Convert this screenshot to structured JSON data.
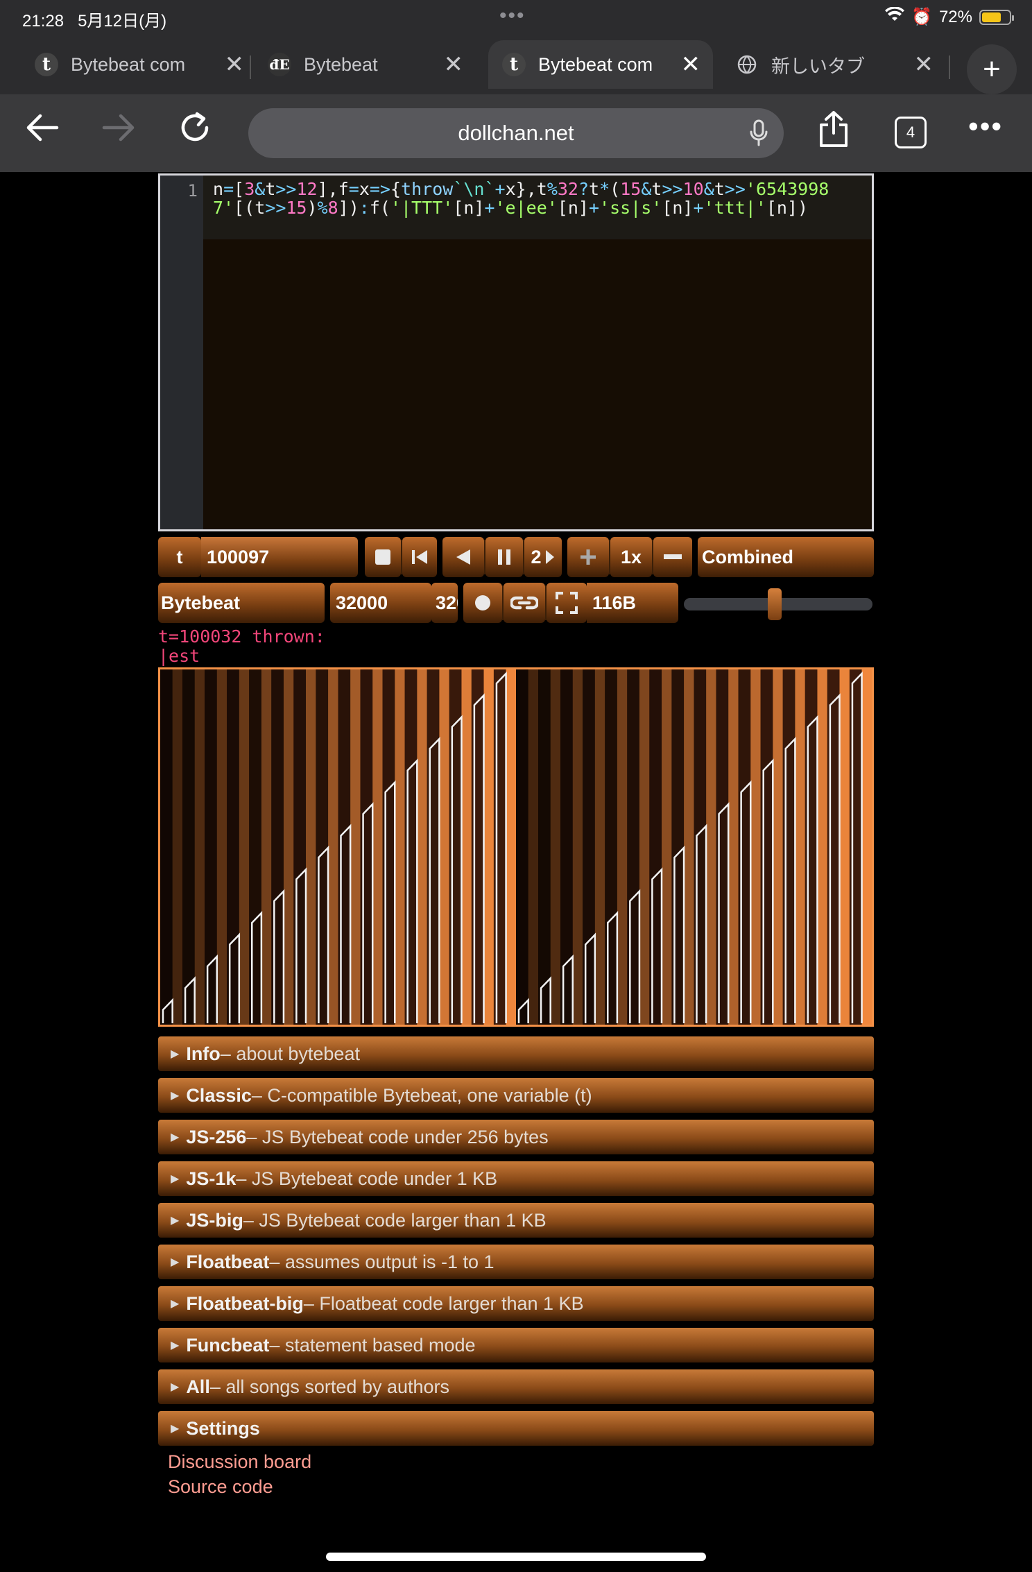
{
  "status_bar": {
    "time": "21:28",
    "date": "5月12日(月)",
    "battery": "72%",
    "battery_level": 0.72
  },
  "tabs": [
    {
      "favicon": "t",
      "title": "Bytebeat com",
      "active": false
    },
    {
      "favicon": "đE",
      "title": "Bytebeat",
      "active": false
    },
    {
      "favicon": "t",
      "title": "Bytebeat com",
      "active": true
    },
    {
      "favicon": "globe-icon",
      "title": "新しいタブ",
      "active": false
    }
  ],
  "toolbar": {
    "url": "dollchan.net",
    "tab_count": "4"
  },
  "editor": {
    "line_number": "1",
    "code": "n=[3&t>>12],f=x=>{throw`\\n`+x},t%32?t*(15&t>>10&t>>'65439987'[(t>>15)%8]):f('|TTT'[n]+'e|ee'[n]+'ss|s'[n]+'ttt|'[n])"
  },
  "controls": {
    "t_label": "t",
    "t_value": "100097",
    "speed_direction_label": "2",
    "speed": "1x",
    "draw_mode": "Combined",
    "mode": "Bytebeat",
    "sample_rate": "32000",
    "sample_rate_select": "32000",
    "size": "116B",
    "volume_level": 0.48
  },
  "error": {
    "line1": "t=100032 thrown:",
    "line2": "|est"
  },
  "sections": [
    {
      "name": "Info",
      "desc": " – about bytebeat"
    },
    {
      "name": "Classic",
      "desc": " – C-compatible Bytebeat, one variable (t)"
    },
    {
      "name": "JS-256",
      "desc": " – JS Bytebeat code under 256 bytes"
    },
    {
      "name": "JS-1k",
      "desc": " – JS Bytebeat code under 1 KB"
    },
    {
      "name": "JS-big",
      "desc": " – JS Bytebeat code larger than 1 KB"
    },
    {
      "name": "Floatbeat",
      "desc": " – assumes output is -1 to 1"
    },
    {
      "name": "Floatbeat-big",
      "desc": " – Floatbeat code larger than 1 KB"
    },
    {
      "name": "Funcbeat",
      "desc": " – statement based mode"
    },
    {
      "name": "All",
      "desc": " – all songs sorted by authors"
    },
    {
      "name": "Settings",
      "desc": ""
    }
  ],
  "links": [
    "Discussion board",
    "Source code"
  ],
  "colors": {
    "accent": "#f39147",
    "error": "#f2467a",
    "link": "#ff9d92"
  }
}
